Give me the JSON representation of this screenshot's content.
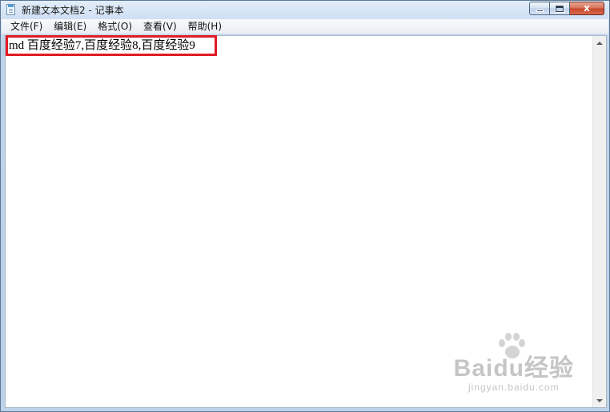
{
  "window": {
    "title": "新建文本文档2 - 记事本",
    "close_label": "x"
  },
  "menu": {
    "items": [
      {
        "label": "文件(F)"
      },
      {
        "label": "编辑(E)"
      },
      {
        "label": "格式(O)"
      },
      {
        "label": "查看(V)"
      },
      {
        "label": "帮助(H)"
      }
    ]
  },
  "editor": {
    "text": "md 百度经验7,百度经验8,百度经验9",
    "highlight_color": "#e21b25"
  },
  "watermark": {
    "brand": "Baidu经验",
    "sub": "jingyan.baidu.com"
  },
  "icons": {
    "app": "notepad-icon",
    "minimize": "minimize-icon",
    "maximize": "maximize-icon",
    "close": "close-icon"
  }
}
